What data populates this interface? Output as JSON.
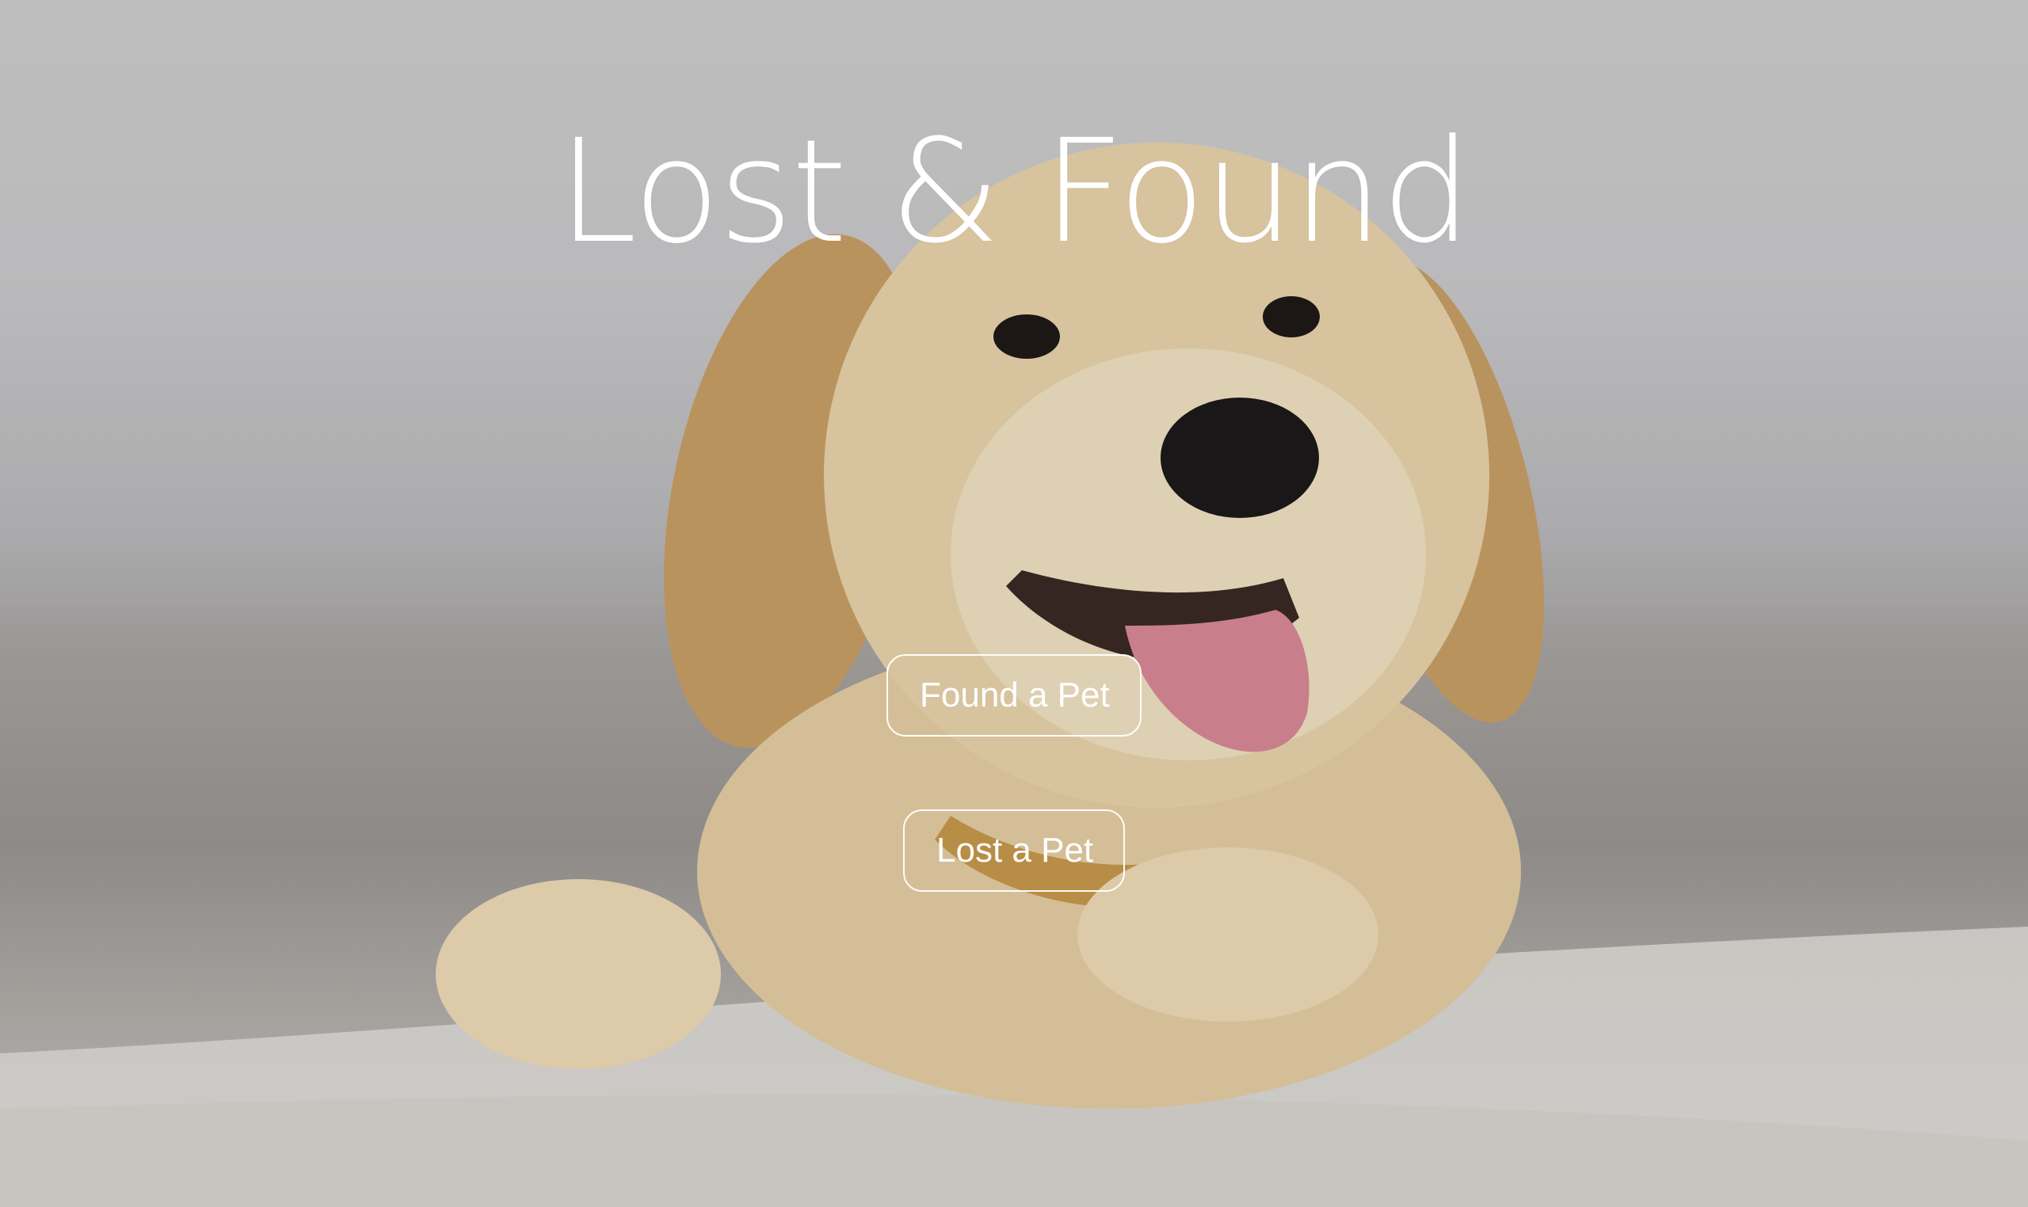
{
  "hero": {
    "title": "Lost & Found",
    "background_image": "golden-retriever-puppy-photo"
  },
  "actions": {
    "found_label": "Found a Pet",
    "lost_label": "Lost a Pet"
  },
  "colors": {
    "text": "#ffffff",
    "button_border": "#ffffff"
  }
}
